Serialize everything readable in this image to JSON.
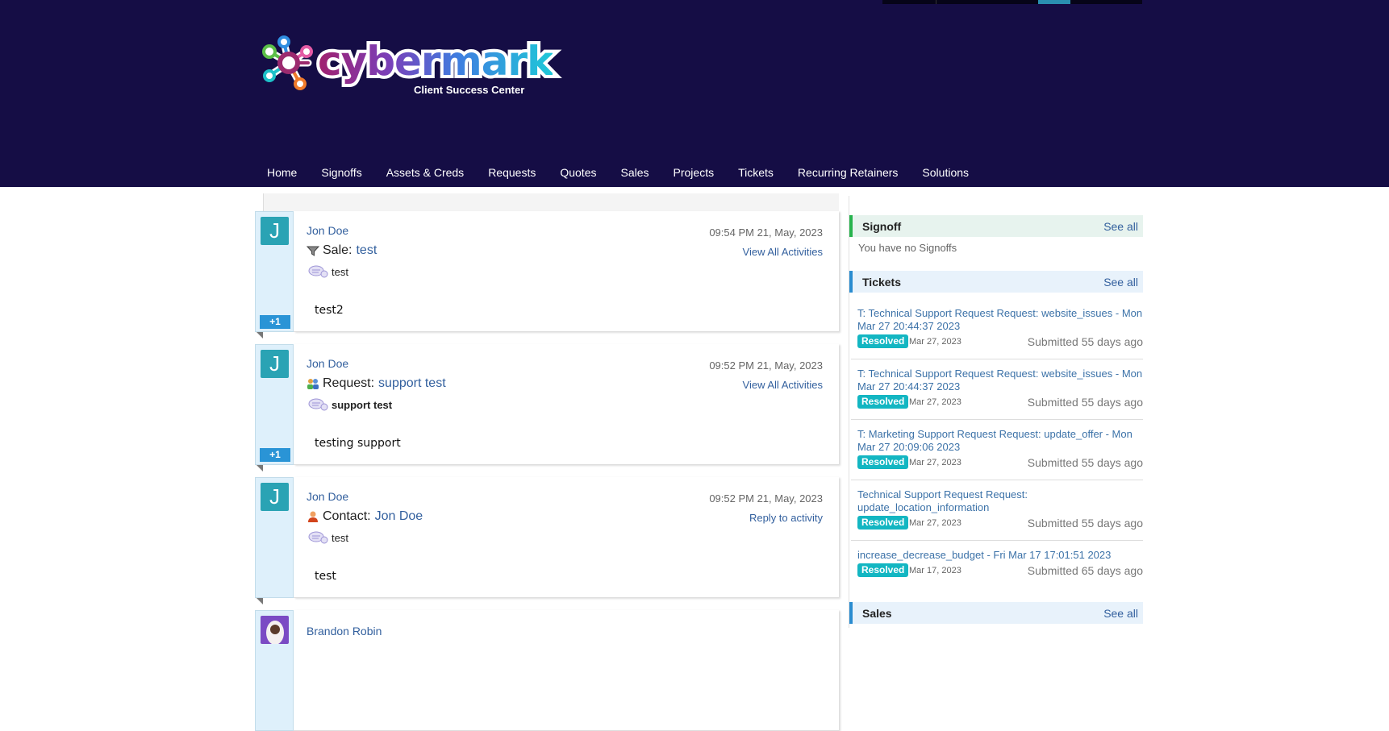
{
  "brand": {
    "name": "cybermark",
    "tagline": "Client Success Center"
  },
  "nav": [
    "Home",
    "Signoffs",
    "Assets & Creds",
    "Requests",
    "Quotes",
    "Sales",
    "Projects",
    "Tickets",
    "Recurring Retainers",
    "Solutions"
  ],
  "activities": [
    {
      "avatar": "J",
      "user": "Jon Doe",
      "time": "09:54 PM 21, May, 2023",
      "action_link": "View All Activities",
      "type_icon": "funnel-icon",
      "type_label": "Sale:",
      "type_link": "test",
      "message": "test",
      "comment": "test2",
      "badge": "+1"
    },
    {
      "avatar": "J",
      "user": "Jon Doe",
      "time": "09:52 PM 21, May, 2023",
      "action_link": "View All Activities",
      "type_icon": "group-icon",
      "type_label": "Request:",
      "type_link": "support test",
      "message": "support test",
      "comment": "testing support",
      "badge": "+1"
    },
    {
      "avatar": "J",
      "user": "Jon Doe",
      "time": "09:52 PM 21, May, 2023",
      "action_link": "Reply to activity",
      "type_icon": "contact-icon",
      "type_label": "Contact:",
      "type_link": "Jon Doe",
      "message": "test",
      "comment": "test",
      "badge": ""
    },
    {
      "avatar": "photo",
      "user": "Brandon Robin",
      "time": "",
      "action_link": "",
      "type_icon": "",
      "type_label": "",
      "type_link": "",
      "message": "",
      "comment": "",
      "badge": ""
    }
  ],
  "sidebar": {
    "signoff": {
      "title": "Signoff",
      "see_all": "See all",
      "empty": "You have no Signoffs",
      "accent": "#27b34d"
    },
    "tickets": {
      "title": "Tickets",
      "see_all": "See all",
      "accent": "#2a8cd0",
      "items": [
        {
          "title": "T: Technical Support Request Request: website_issues - Mon Mar 27 20:44:37 2023",
          "status": "Resolved",
          "date": "Mar 27, 2023",
          "submitted": "Submitted 55 days ago"
        },
        {
          "title": "T: Technical Support Request Request: website_issues - Mon Mar 27 20:44:37 2023",
          "status": "Resolved",
          "date": "Mar 27, 2023",
          "submitted": "Submitted 55 days ago"
        },
        {
          "title": "T: Marketing Support Request Request: update_offer - Mon Mar 27 20:09:06 2023",
          "status": "Resolved",
          "date": "Mar 27, 2023",
          "submitted": "Submitted 55 days ago"
        },
        {
          "title": "Technical Support Request Request: update_location_information",
          "status": "Resolved",
          "date": "Mar 27, 2023",
          "submitted": "Submitted 55 days ago"
        },
        {
          "title": "increase_decrease_budget - Fri Mar 17 17:01:51 2023",
          "status": "Resolved",
          "date": "Mar 17, 2023",
          "submitted": "Submitted 65 days ago"
        }
      ]
    },
    "sales": {
      "title": "Sales",
      "see_all": "See all"
    }
  },
  "colors": {
    "header_bg": "#150d45",
    "link": "#33609e",
    "resolved": "#13b6c2",
    "avatar": "#2aa3b4",
    "badge": "#2a94d6"
  }
}
